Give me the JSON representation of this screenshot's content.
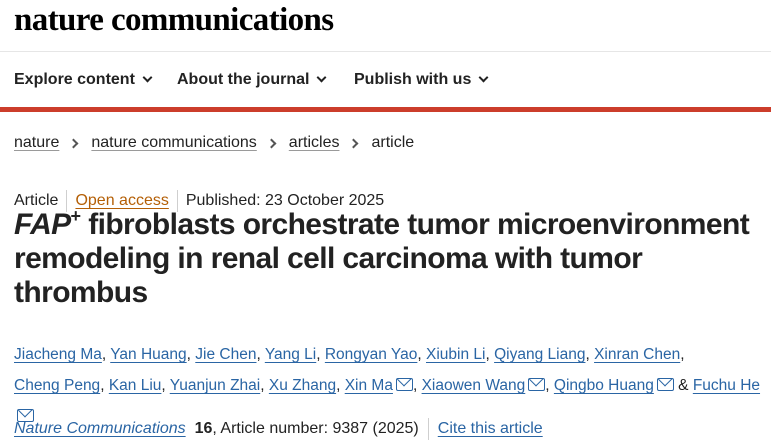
{
  "site": {
    "logo": "nature communications"
  },
  "nav": {
    "items": [
      {
        "label": "Explore content"
      },
      {
        "label": "About the journal"
      },
      {
        "label": "Publish with us"
      }
    ]
  },
  "breadcrumb": {
    "items": [
      "nature",
      "nature communications",
      "articles"
    ],
    "current": "article"
  },
  "meta": {
    "type": "Article",
    "access": "Open access",
    "published": "Published: 23 October 2025"
  },
  "article": {
    "title_gene": "FAP",
    "title_sup": "+",
    "title_rest": " fibroblasts orchestrate tumor microenvironment remodeling in renal cell carcinoma with tumor thrombus"
  },
  "authors": [
    "Jiacheng Ma",
    "Yan Huang",
    "Jie Chen",
    "Yang Li",
    "Rongyan Yao",
    "Xiubin Li",
    "Qiyang Liang",
    "Xinran Chen",
    "Cheng Peng",
    "Kan Liu",
    "Yuanjun Zhai",
    "Xu Zhang",
    "Xin Ma",
    "Xiaowen Wang",
    "Qingbo Huang",
    "Fuchu He"
  ],
  "author_sep": ",",
  "author_last_sep": "&",
  "citation": {
    "journal": "Nature Communications",
    "volume": "16",
    "article_number": ", Article number: 9387 (2025)",
    "cite_label": "Cite this article"
  },
  "colors": {
    "accent_red": "#cc3d2b",
    "link_blue": "#2a65a4",
    "open_access": "#b45f06"
  }
}
